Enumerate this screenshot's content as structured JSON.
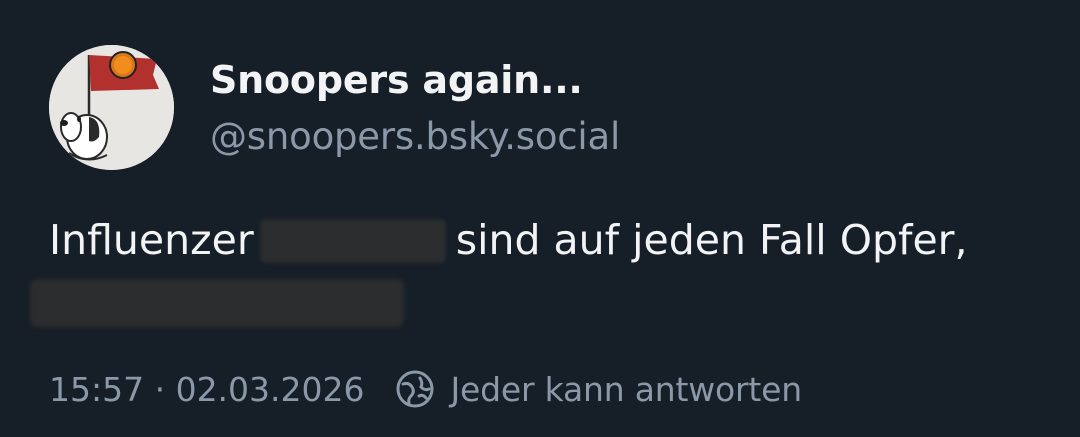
{
  "post": {
    "author": {
      "display_name": "Snoopers again...",
      "handle": "@snoopers.bsky.social",
      "avatar_icon": "snoopy-flag-avatar"
    },
    "text": {
      "part1": "Influenzer",
      "part2": "sind auf jeden Fall Opfer,"
    },
    "meta": {
      "timestamp": "15:57 · 02.03.2026",
      "reply_icon": "globe-icon",
      "reply_setting": "Jeder kann antworten"
    }
  },
  "colors": {
    "background": "#161e27",
    "primary_text": "#f1f3f5",
    "secondary_text": "#8b98a8",
    "redaction": "#2b2d2f"
  }
}
